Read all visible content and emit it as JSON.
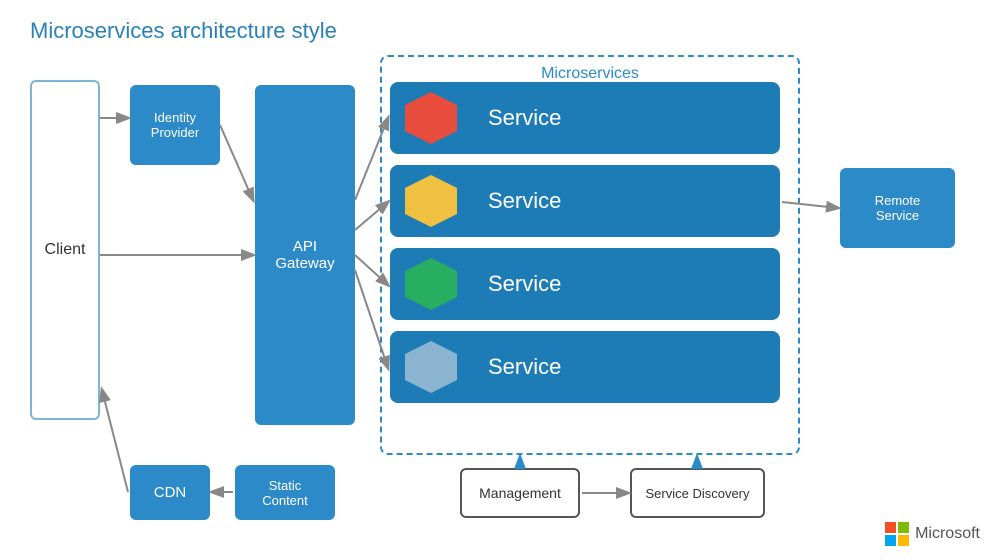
{
  "title": "Microservices architecture style",
  "client": {
    "label": "Client"
  },
  "identity_provider": {
    "label": "Identity\nProvider"
  },
  "api_gateway": {
    "label": "API\nGateway"
  },
  "microservices": {
    "label": "Microservices",
    "services": [
      {
        "label": "Service",
        "hex_color": "red"
      },
      {
        "label": "Service",
        "hex_color": "yellow"
      },
      {
        "label": "Service",
        "hex_color": "green"
      },
      {
        "label": "Service",
        "hex_color": "blue-gray"
      }
    ]
  },
  "remote_service": {
    "label": "Remote\nService"
  },
  "cdn": {
    "label": "CDN"
  },
  "static_content": {
    "label": "Static\nContent"
  },
  "management": {
    "label": "Management"
  },
  "service_discovery": {
    "label": "Service Discovery"
  },
  "microsoft": {
    "label": "Microsoft"
  },
  "colors": {
    "blue": "#2b8ac7",
    "dark_blue": "#1d7cb5",
    "arrow": "#888888"
  }
}
